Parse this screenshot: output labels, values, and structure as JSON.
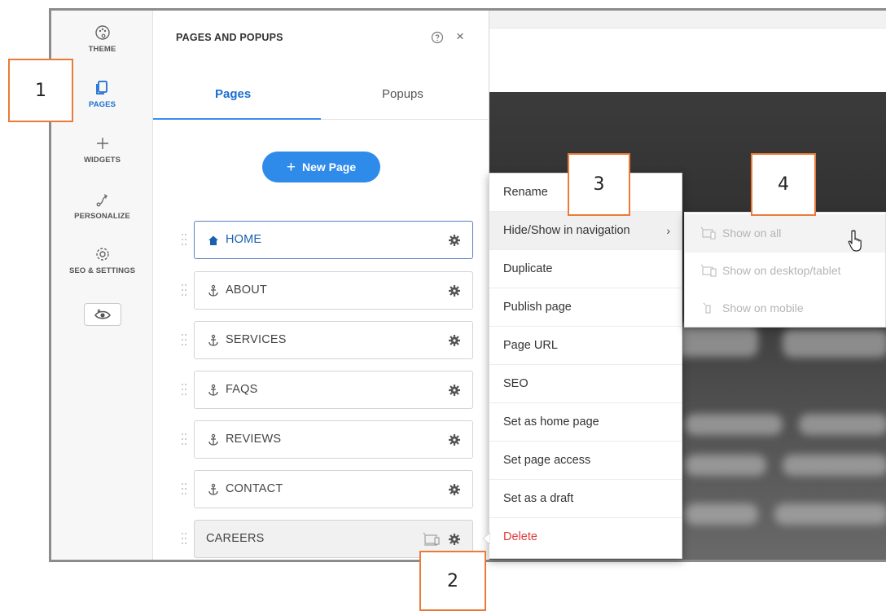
{
  "rail": {
    "items": [
      {
        "label": "THEME",
        "icon": "palette-icon"
      },
      {
        "label": "PAGES",
        "icon": "pages-icon"
      },
      {
        "label": "WIDGETS",
        "icon": "plus-icon"
      },
      {
        "label": "PERSONALIZE",
        "icon": "personalize-icon"
      },
      {
        "label": "SEO & SETTINGS",
        "icon": "gear-icon"
      }
    ],
    "active": "PAGES",
    "preview_icon": "eye-icon"
  },
  "panel": {
    "title": "PAGES AND POPUPS",
    "tabs": [
      {
        "label": "Pages"
      },
      {
        "label": "Popups"
      }
    ],
    "new_page_label": "New Page",
    "pages": [
      {
        "label": "HOME",
        "icon": "home-icon"
      },
      {
        "label": "ABOUT",
        "icon": "anchor-icon"
      },
      {
        "label": "SERVICES",
        "icon": "anchor-icon"
      },
      {
        "label": "FAQS",
        "icon": "anchor-icon"
      },
      {
        "label": "REVIEWS",
        "icon": "anchor-icon"
      },
      {
        "label": "CONTACT",
        "icon": "anchor-icon"
      },
      {
        "label": "CAREERS",
        "icon": "hidden-nav-icon"
      }
    ]
  },
  "context_menu": {
    "items": [
      {
        "label": "Rename"
      },
      {
        "label": "Hide/Show in navigation",
        "chevron": "›"
      },
      {
        "label": "Duplicate"
      },
      {
        "label": "Publish page"
      },
      {
        "label": "Page URL"
      },
      {
        "label": "SEO"
      },
      {
        "label": "Set as home page"
      },
      {
        "label": "Set page access"
      },
      {
        "label": "Set as a draft"
      },
      {
        "label": "Delete"
      }
    ]
  },
  "submenu": {
    "items": [
      {
        "label": "Show on all",
        "icon": "desktop-mobile-icon"
      },
      {
        "label": "Show on desktop/tablet",
        "icon": "desktop-tablet-icon"
      },
      {
        "label": "Show on mobile",
        "icon": "mobile-icon"
      }
    ]
  },
  "callouts": [
    "1",
    "2",
    "3",
    "4"
  ],
  "colors": {
    "accent": "#2f8bea",
    "callout_border": "#e87b3a",
    "danger": "#e03a3a"
  }
}
